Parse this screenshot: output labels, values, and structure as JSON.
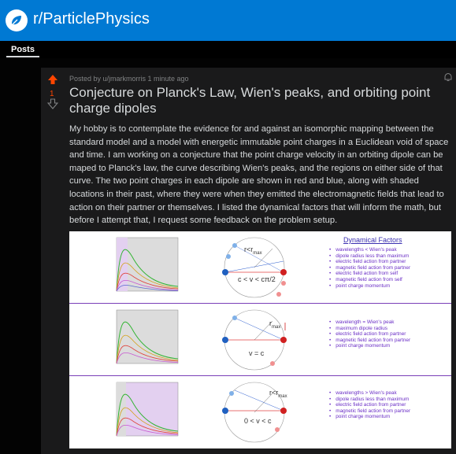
{
  "header": {
    "subreddit": "r/ParticlePhysics"
  },
  "tabs": {
    "posts": "Posts"
  },
  "post": {
    "vote_count": "1",
    "meta": "Posted by u/jmarkmorris 1 minute ago",
    "title": "Conjecture on Planck's Law, Wien's peaks, and orbiting point charge dipoles",
    "body": "My hobby is to contemplate the evidence for and against an isomorphic mapping between the standard model and a model with energetic immutable point charges in a Euclidean void of space and time. I am working on a conjecture that the point charge velocity in an orbiting dipole can be maped to Planck's law, the curve describing Wien's peaks, and the regions on either side of that curve. The two point charges in each dipole are shown in red and blue, along with shaded locations in their past, where they were when they emitted the electromagnetic fields that lead to action on their partner or themselves. I listed the dynamical factors that will inform the math, but before I attempt that, I request some feedback on the problem setup."
  },
  "figure": {
    "title": "Dynamical Factors",
    "rows": [
      {
        "formula": "c < v < cπ/2",
        "radius_label": "r<r",
        "radius_sub": "max",
        "factors": [
          "wavelengths < Wien's peak",
          "dipole radius less than maximum",
          "electric field action from partner",
          "magnetic field action from partner",
          "electric field action from self",
          "magnetic field action from self",
          "point charge momentum"
        ]
      },
      {
        "formula": "v = c",
        "radius_label": "r",
        "radius_sub": "max",
        "factors": [
          "wavelength = Wien's peak",
          "maximum dipole radius",
          "electric field action from partner",
          "magnetic field action from partner",
          "point charge momentum"
        ]
      },
      {
        "formula": "0 < v < c",
        "radius_label": "r<r",
        "radius_sub": "max",
        "factors": [
          "wavelengths > Wien's peak",
          "dipole radius less than maximum",
          "electric field action from partner",
          "magnetic field action from partner",
          "point charge momentum"
        ]
      }
    ]
  },
  "colors": {
    "header": "#0079d3",
    "upvote": "#ff4500",
    "factor_text": "#6b2fc6"
  }
}
